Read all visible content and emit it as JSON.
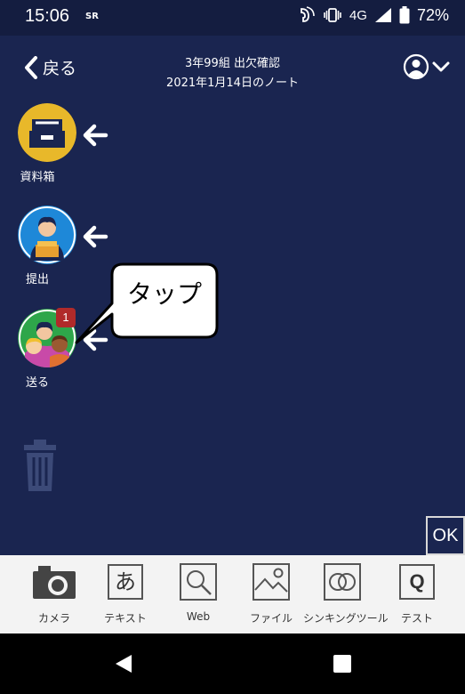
{
  "status": {
    "time": "15:06",
    "carrier": "SR",
    "network": "4G",
    "battery": "72%"
  },
  "header": {
    "back_label": "戻る",
    "title_line1": "3年99組 出欠確認",
    "title_line2": "2021年1月14日のノート"
  },
  "side": [
    {
      "label": "資料箱"
    },
    {
      "label": "提出"
    },
    {
      "label": "送る",
      "badge": "1"
    }
  ],
  "callout": {
    "text": "タップ"
  },
  "ok_label": "OK",
  "toolbar": {
    "items": [
      {
        "label": "カメラ"
      },
      {
        "label": "テキスト",
        "glyph": "あ"
      },
      {
        "label": "Web"
      },
      {
        "label": "ファイル"
      },
      {
        "label": "シンキングツール"
      },
      {
        "label": "テスト",
        "glyph": "Q"
      }
    ]
  },
  "colors": {
    "background": "#1a2550",
    "accent_yellow": "#e8b82a",
    "accent_blue": "#1e88d8",
    "accent_green": "#2ea64a",
    "badge": "#b02a2a"
  }
}
